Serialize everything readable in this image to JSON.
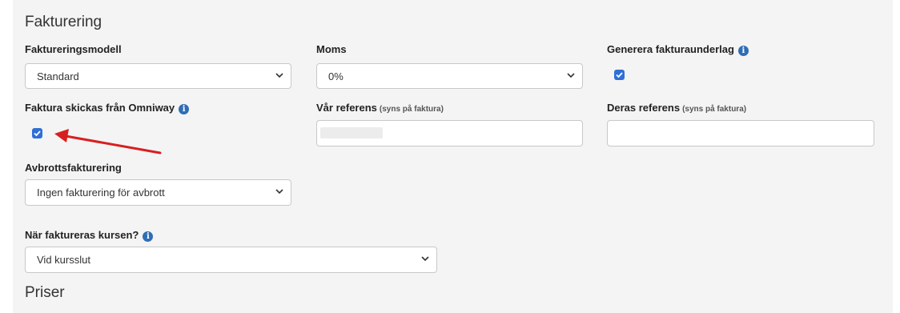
{
  "billing": {
    "title": "Fakturering",
    "billing_model": {
      "label": "Faktureringsmodell",
      "value": "Standard"
    },
    "vat": {
      "label": "Moms",
      "value": "0%"
    },
    "generate_basis": {
      "label": "Generera fakturaunderlag",
      "checked": true
    },
    "sent_from_omniway": {
      "label": "Faktura skickas från Omniway",
      "checked": true
    },
    "our_reference": {
      "label": "Vår referens",
      "hint": "(syns på faktura)",
      "value": ""
    },
    "their_reference": {
      "label": "Deras referens",
      "hint": "(syns på faktura)",
      "value": ""
    },
    "cancellation_billing": {
      "label": "Avbrottsfakturering",
      "value": "Ingen fakturering för avbrott"
    },
    "when_billed": {
      "label": "När faktureras kursen?",
      "value": "Vid kursslut"
    }
  },
  "prices": {
    "title": "Priser"
  },
  "colors": {
    "accent": "#2f6fd6",
    "info": "#2f6db5",
    "arrow": "#d81f1f",
    "panel": "#f4f4f4"
  },
  "icons": {
    "info": "info-icon",
    "chevron": "chevron-down-icon",
    "check": "check-icon"
  }
}
